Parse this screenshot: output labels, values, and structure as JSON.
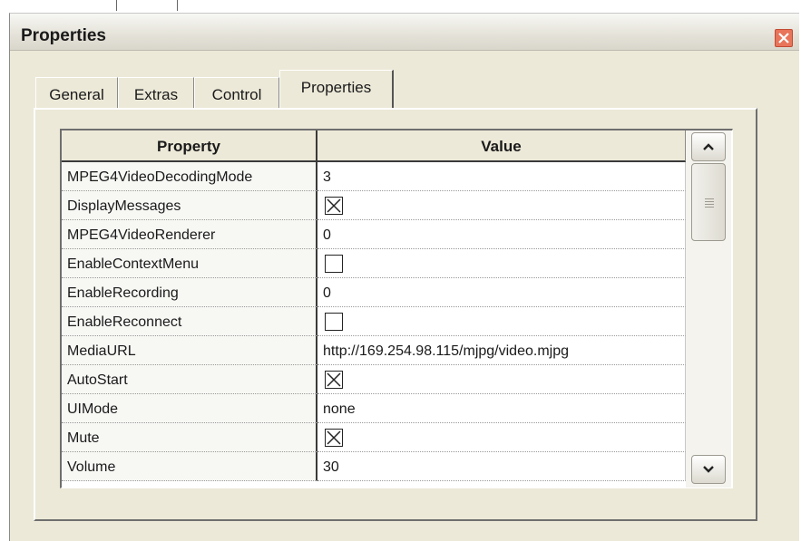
{
  "window": {
    "title": "Properties"
  },
  "tabs": [
    {
      "label": "General",
      "active": false
    },
    {
      "label": "Extras",
      "active": false
    },
    {
      "label": "Control",
      "active": false
    },
    {
      "label": "Properties",
      "active": true
    }
  ],
  "grid": {
    "headers": {
      "property": "Property",
      "value": "Value"
    },
    "rows": [
      {
        "name": "MPEG4VideoDecodingMode",
        "type": "text",
        "value": "3"
      },
      {
        "name": "DisplayMessages",
        "type": "checkbox",
        "checked": true
      },
      {
        "name": "MPEG4VideoRenderer",
        "type": "text",
        "value": "0"
      },
      {
        "name": "EnableContextMenu",
        "type": "checkbox",
        "checked": false
      },
      {
        "name": "EnableRecording",
        "type": "text",
        "value": "0"
      },
      {
        "name": "EnableReconnect",
        "type": "checkbox",
        "checked": false
      },
      {
        "name": "MediaURL",
        "type": "text",
        "value": "http://169.254.98.115/mjpg/video.mjpg"
      },
      {
        "name": "AutoStart",
        "type": "checkbox",
        "checked": true
      },
      {
        "name": "UIMode",
        "type": "text",
        "value": "none"
      },
      {
        "name": "Mute",
        "type": "checkbox",
        "checked": true
      },
      {
        "name": "Volume",
        "type": "text",
        "value": "30"
      }
    ]
  },
  "icons": {
    "close": "close-icon",
    "scroll_up": "scroll-up-arrow-icon",
    "scroll_down": "scroll-down-arrow-icon"
  },
  "colors": {
    "close_button": "#e8745a",
    "dialog_bg": "#ece9d8"
  }
}
